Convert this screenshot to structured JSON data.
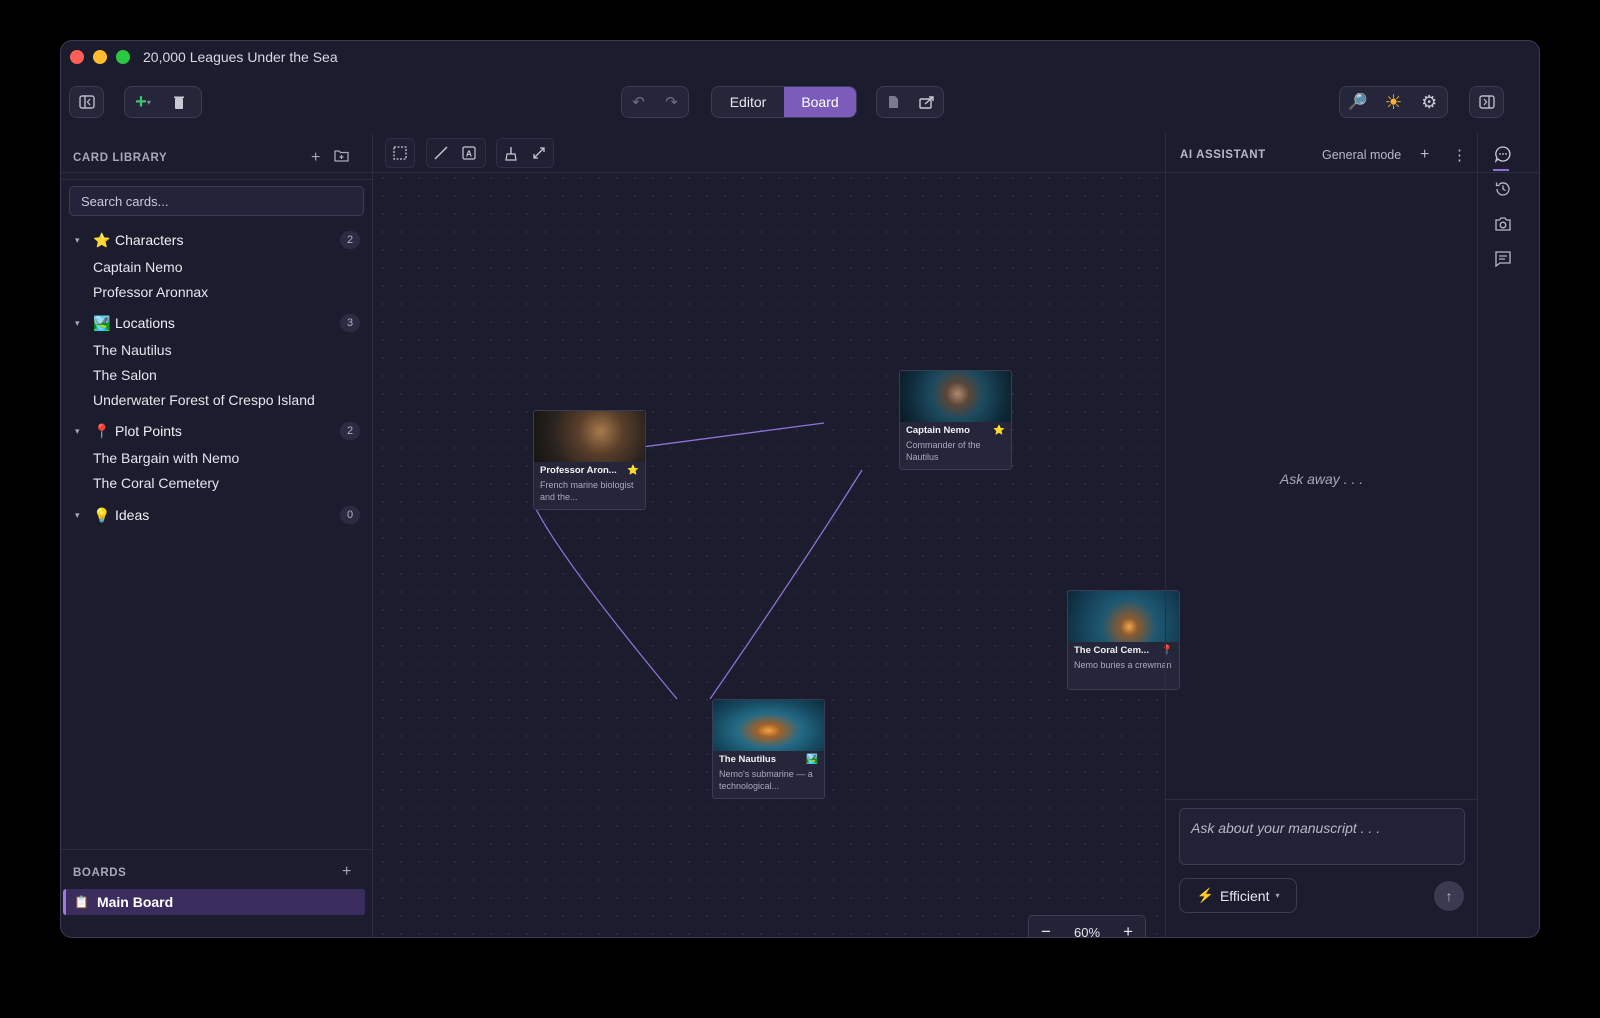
{
  "window": {
    "title": "20,000 Leagues Under the Sea"
  },
  "toolbar": {
    "view_editor": "Editor",
    "view_board": "Board",
    "icons": [
      "sidebar-toggle-icon",
      "add-card-icon",
      "trash-icon",
      "undo-icon",
      "redo-icon",
      "document-icon",
      "export-icon",
      "search-icon",
      "theme-icon",
      "settings-icon",
      "right-panel-toggle-icon"
    ]
  },
  "library": {
    "title": "CARD LIBRARY",
    "search_placeholder": "Search cards...",
    "categories": [
      {
        "name": "Characters",
        "icon": "⭐",
        "count": "2",
        "items": [
          "Captain Nemo",
          "Professor Aronnax"
        ]
      },
      {
        "name": "Locations",
        "icon": "🏞️",
        "count": "3",
        "items": [
          "The Nautilus",
          "The Salon",
          "Underwater Forest of Crespo Island"
        ]
      },
      {
        "name": "Plot Points",
        "icon": "📍",
        "count": "2",
        "items": [
          "The Bargain with Nemo",
          "The Coral Cemetery"
        ]
      },
      {
        "name": "Ideas",
        "icon": "💡",
        "count": "0",
        "items": []
      }
    ]
  },
  "boards": {
    "title": "BOARDS",
    "items": [
      {
        "label": "Main Board",
        "icon": "📋"
      }
    ]
  },
  "board": {
    "zoom": "60%",
    "cards": [
      {
        "title": "Professor Aron...",
        "badge": "⭐",
        "desc": "French marine biologist and the..."
      },
      {
        "title": "Captain Nemo",
        "badge": "⭐",
        "desc": "Commander of the Nautilus"
      },
      {
        "title": "The Coral Cem...",
        "badge": "📍",
        "desc": "Nemo buries a crewman"
      },
      {
        "title": "The Nautilus",
        "badge": "🏞️",
        "desc": "Nemo's submarine — a technological..."
      }
    ],
    "links": [
      [
        "Professor Aronnax",
        "Captain Nemo"
      ],
      [
        "Professor Aronnax",
        "The Nautilus"
      ],
      [
        "Captain Nemo",
        "The Nautilus"
      ]
    ]
  },
  "assistant": {
    "title": "AI ASSISTANT",
    "mode": "General mode",
    "empty_text": "Ask away . . .",
    "input_placeholder": "Ask about your manuscript . . .",
    "model_label": "Efficient"
  },
  "rail": {
    "icons": [
      "chat-icon",
      "history-icon",
      "camera-icon",
      "notes-icon"
    ]
  },
  "colors": {
    "accent": "#7c5cba",
    "link_line": "#8e72d6",
    "background": "#1b1c2e"
  }
}
